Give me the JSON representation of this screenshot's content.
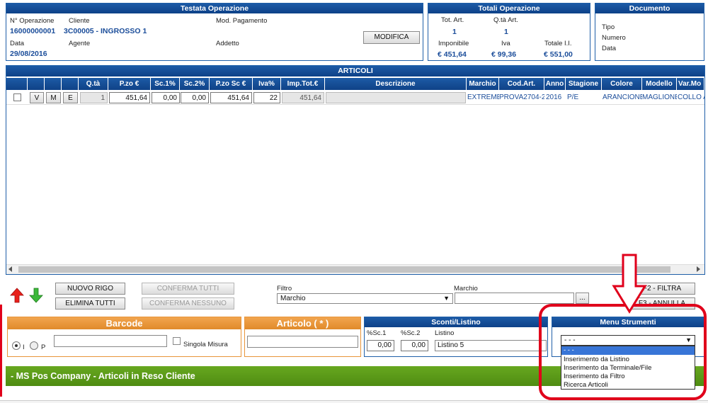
{
  "testata": {
    "title": "Testata Operazione",
    "n_operazione_label": "N° Operazione",
    "n_operazione": "16000000001",
    "cliente_label": "Cliente",
    "cliente": "3C00005 - INGROSSO 1",
    "mod_pagamento_label": "Mod. Pagamento",
    "data_label": "Data",
    "data": "29/08/2016",
    "agente_label": "Agente",
    "addetto_label": "Addetto",
    "modifica_button": "MODIFICA"
  },
  "totali": {
    "title": "Totali Operazione",
    "tot_art_label": "Tot. Art.",
    "tot_art": "1",
    "qta_art_label": "Q.tà Art.",
    "qta_art": "1",
    "imponibile_label": "Imponibile",
    "imponibile": "€ 451,64",
    "iva_label": "Iva",
    "iva": "€ 99,36",
    "totale_label": "Totale I.I.",
    "totale": "€ 551,00"
  },
  "documento": {
    "title": "Documento",
    "tipo_label": "Tipo",
    "numero_label": "Numero",
    "data_label": "Data"
  },
  "articoli": {
    "title": "ARTICOLI",
    "headers": {
      "qta": "Q.tà",
      "pzo": "P.zo €",
      "sc1": "Sc.1%",
      "sc2": "Sc.2%",
      "pzo_sc": "P.zo Sc €",
      "iva": "Iva%",
      "imp_tot": "Imp.Tot.€",
      "descrizione": "Descrizione",
      "marchio": "Marchio",
      "cod_art": "Cod.Art.",
      "anno": "Anno",
      "stagione": "Stagione",
      "colore": "Colore",
      "modello": "Modello",
      "var_mo": "Var.Mo"
    },
    "row": {
      "v": "V",
      "m": "M",
      "e": "E",
      "qta": "1",
      "pzo": "451,64",
      "sc1": "0,00",
      "sc2": "0,00",
      "pzo_sc": "451,64",
      "iva": "22",
      "imp_tot": "451,64",
      "descrizione": "",
      "marchio": "EXTREME",
      "cod_art": "PROVA2704-2",
      "anno": "2016",
      "stagione": "P/E",
      "colore": "ARANCIONE",
      "modello": "MAGLIONE",
      "var_mo": "COLLO A"
    }
  },
  "toolbar": {
    "nuovo_rigo": "NUOVO RIGO",
    "elimina_tutti": "ELIMINA TUTTI",
    "conferma_tutti": "CONFERMA TUTTI",
    "conferma_nessuno": "CONFERMA NESSUNO",
    "filtro_label": "Filtro",
    "filtro_value": "Marchio",
    "marchio_label": "Marchio",
    "marchio_value": "",
    "ellipsis": "...",
    "f2_filtra": "F2 - FILTRA",
    "annulla": "F3 - ANNULLA"
  },
  "barcode": {
    "title": "Barcode",
    "radio_i": "I",
    "radio_p": "P",
    "singola_misura": "Singola Misura"
  },
  "articolo": {
    "title": "Articolo ( * )"
  },
  "sconti": {
    "title": "Sconti/Listino",
    "sc1_label": "%Sc.1",
    "sc2_label": "%Sc.2",
    "listino_label": "Listino",
    "sc1": "0,00",
    "sc2": "0,00",
    "listino": "Listino 5"
  },
  "menu_strumenti": {
    "title": "Menu Strumenti",
    "selected": "- - -",
    "options": [
      "- - -",
      "Inserimento da Listino",
      "Inserimento da Terminale/File",
      "Inserimento da Filtro",
      "Ricerca Articoli"
    ]
  },
  "footer_bar": {
    "title": "- MS Pos Company - Articoli in Reso Cliente"
  },
  "colors": {
    "header_blue": "#1c5aa6",
    "orange": "#e8953a",
    "green_bar": "#5a9a18",
    "highlight_red": "#e0001b",
    "selection_blue": "#3875d7"
  }
}
